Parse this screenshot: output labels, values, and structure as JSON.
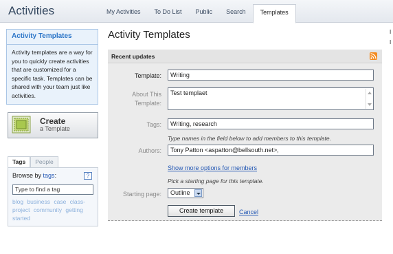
{
  "header": {
    "app_title": "Activities",
    "tabs": [
      {
        "label": "My Activities",
        "active": false
      },
      {
        "label": "To Do List",
        "active": false
      },
      {
        "label": "Public",
        "active": false
      },
      {
        "label": "Search",
        "active": false
      },
      {
        "label": "Templates",
        "active": true
      }
    ]
  },
  "sidebar": {
    "info_title": "Activity Templates",
    "info_text": "Activity templates are a way for you to quickly create activities that are customized for a specific task. Templates can be shared with your team just like activities.",
    "create_button": {
      "main": "Create",
      "sub": "a Template"
    },
    "tags_panel": {
      "tabs": [
        {
          "label": "Tags",
          "active": true
        },
        {
          "label": "People",
          "active": false
        }
      ],
      "browse_prefix": "Browse by",
      "browse_link": "tags",
      "browse_suffix": ":",
      "help": "?",
      "input_value": "Type to find a tag",
      "tag_cloud": [
        "blog",
        "business",
        "case",
        "class-project",
        "community",
        "getting",
        "started"
      ]
    }
  },
  "main": {
    "page_title": "Activity Templates",
    "panel_title": "Recent updates",
    "form": {
      "template_label": "Template:",
      "template_value": "Writing",
      "about_label_1": "About This",
      "about_label_2": "Template:",
      "about_value": "Test templaet",
      "tags_label": "Tags:",
      "tags_value": "Writing, research",
      "members_hint": "Type names in the field below to add members to this template.",
      "authors_label": "Authors:",
      "authors_value": "Tony Patton <aspatton@bellsouth.net>,",
      "more_options_link": "Show more options for members",
      "start_hint": "Pick a starting page for this template.",
      "starting_page_label": "Starting page:",
      "starting_page_value": "Outline",
      "create_button": "Create template",
      "cancel_link": "Cancel"
    }
  },
  "right_edge_marks": [
    "I",
    "I"
  ],
  "colors": {
    "link": "#2458b4",
    "sidebar_title": "#2a74c7",
    "rss": "#f38a1f",
    "panel_bg": "#ebebeb"
  }
}
